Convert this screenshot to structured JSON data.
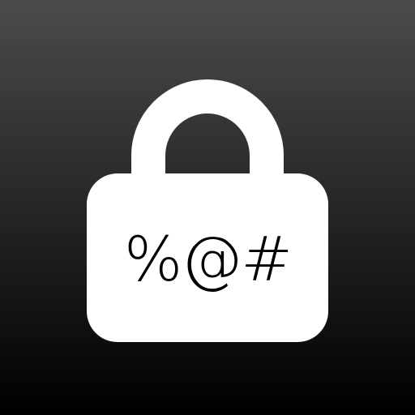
{
  "icon": {
    "name": "lock-icon",
    "symbols_text": "%@#"
  },
  "colors": {
    "background_top": "#4b4b4b",
    "background_bottom": "#000000",
    "lock": "#ffffff",
    "symbols": "#000000"
  }
}
